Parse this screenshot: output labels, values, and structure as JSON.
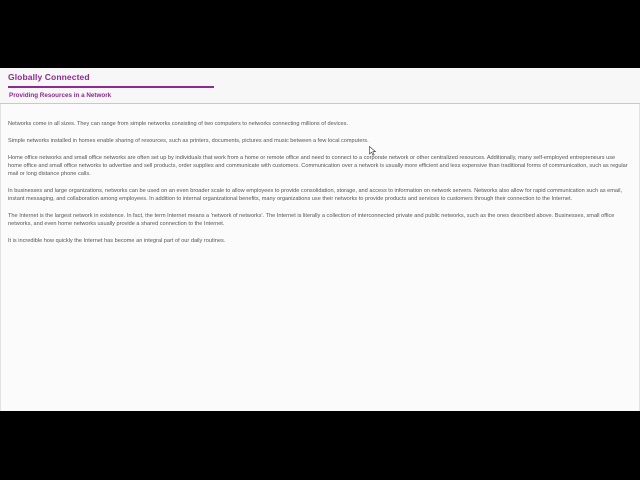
{
  "header": {
    "title": "Globally Connected",
    "subtitle": "Providing Resources in a Network"
  },
  "paragraphs": [
    "Networks come in all sizes. They can range from simple networks consisting of two computers to networks connecting millions of devices.",
    "Simple networks installed in homes enable sharing of resources, such as printers, documents, pictures and music between a few local computers.",
    "Home office networks and small office networks are often set up by individuals that work from a home or remote office and need to connect to a corporate network or other centralized resources. Additionally, many self-employed entrepreneurs use home office and small office networks to advertise and sell products, order supplies and communicate with customers. Communication over a network is usually more efficient and less expensive than traditional forms of communication, such as regular mail or long distance phone calls.",
    "In businesses and large organizations, networks can be used on an even broader scale to allow employees to provide consolidation, storage, and access to information on network servers. Networks also allow for rapid communication such as email, instant messaging, and collaboration among employees. In addition to internal organizational benefits, many organizations use their networks to provide products and services to customers through their connection to the Internet.",
    "The Internet is the largest network in existence. In fact, the term Internet means a 'network of networks'. The Internet is literally a collection of interconnected private and public networks, such as the ones described above. Businesses, small office networks, and even home networks usually provide a shared connection to the Internet.",
    "It is incredible how quickly the Internet has become an integral part of our daily routines."
  ],
  "colors": {
    "accent": "#8e2a91",
    "text": "#555555",
    "background": "#fbfbfb",
    "letterbox": "#000000"
  },
  "icons": {
    "cursor": "mouse-pointer-icon"
  }
}
